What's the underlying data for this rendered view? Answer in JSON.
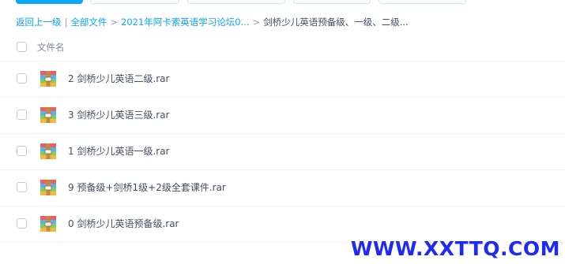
{
  "breadcrumb": {
    "back": "返回上一级",
    "divider": "|",
    "all_files": "全部文件",
    "sep": ">",
    "folder1": "2021年阿卡索英语学习论坛0...",
    "current": "剑桥少儿英语预备级、一级、二级..."
  },
  "list": {
    "header_name": "文件名",
    "files": [
      {
        "name": "2 剑桥少儿英语二级.rar",
        "icon": "rar-archive-icon"
      },
      {
        "name": "3 剑桥少儿英语三级.rar",
        "icon": "rar-archive-icon"
      },
      {
        "name": "1 剑桥少儿英语一级.rar",
        "icon": "rar-archive-icon"
      },
      {
        "name": "9 预备级+剑桥1级+2级全套课件.rar",
        "icon": "rar-archive-icon"
      },
      {
        "name": "0 剑桥少儿英语预备级.rar",
        "icon": "rar-archive-icon"
      }
    ]
  },
  "watermark": "WWW.XXTTQ.COM",
  "colors": {
    "accent": "#06a7ff",
    "text": "#424e67",
    "watermark": "#1f2bf2"
  }
}
